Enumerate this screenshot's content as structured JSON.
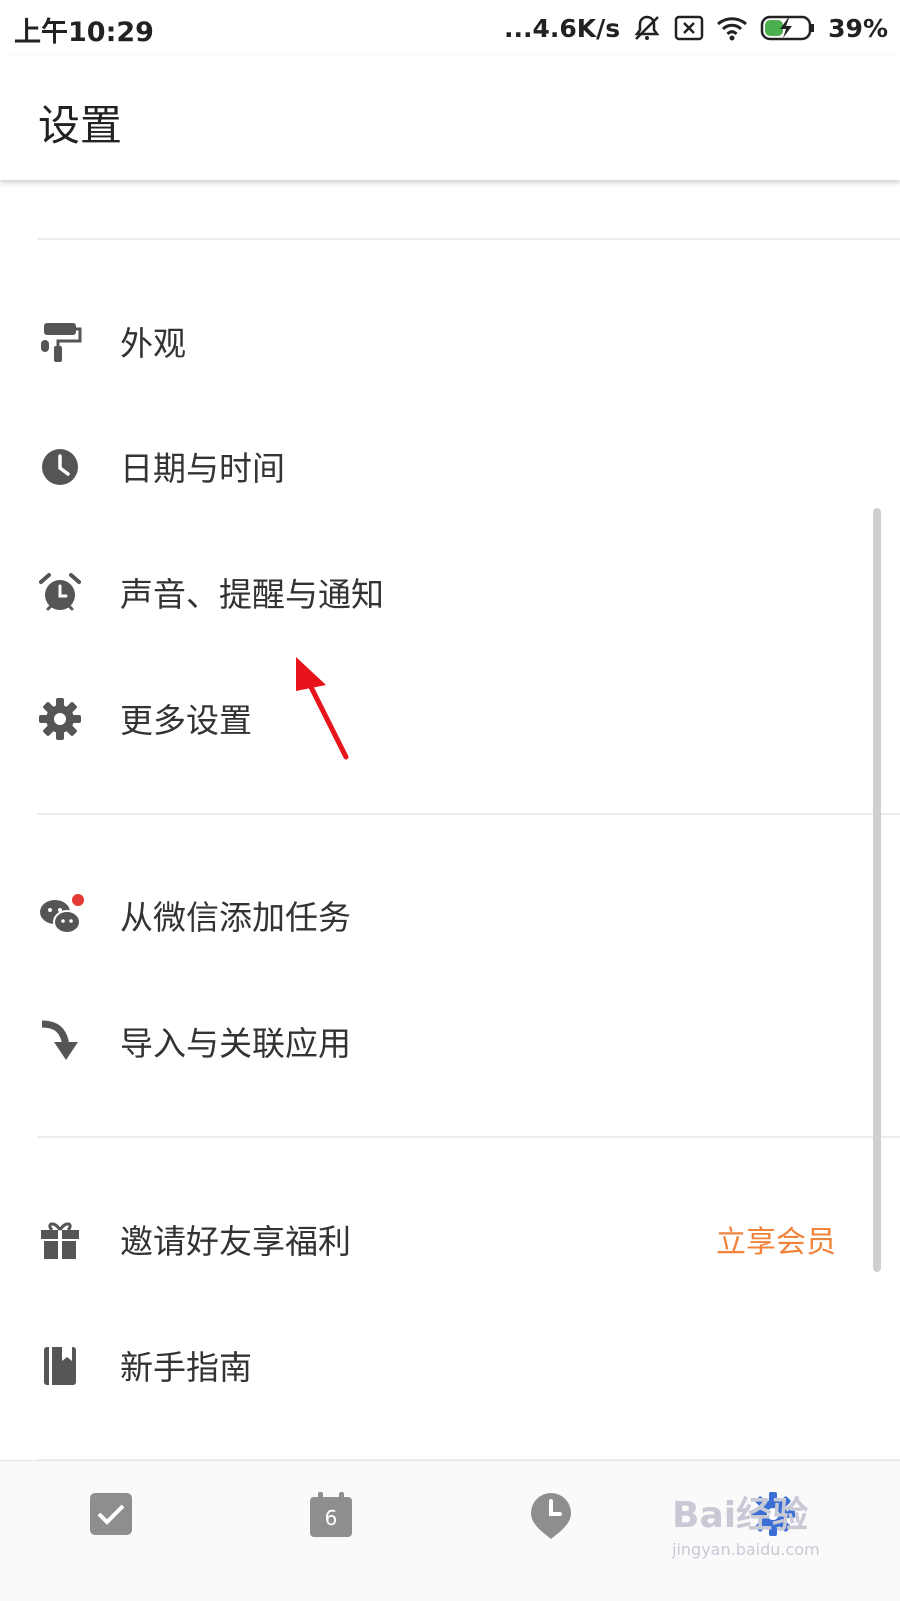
{
  "status_bar": {
    "time": "上午10:29",
    "network_speed": "...4.6K/s",
    "battery": "39%"
  },
  "header": {
    "title": "设置"
  },
  "groups": [
    {
      "items": [
        {
          "label": "外观",
          "icon": "paint-roller-icon"
        },
        {
          "label": "日期与时间",
          "icon": "clock-icon"
        },
        {
          "label": "声音、提醒与通知",
          "icon": "alarm-clock-icon"
        },
        {
          "label": "更多设置",
          "icon": "gear-icon"
        }
      ]
    },
    {
      "items": [
        {
          "label": "从微信添加任务",
          "icon": "wechat-icon",
          "has_red_dot": true
        },
        {
          "label": "导入与关联应用",
          "icon": "import-arrow-icon"
        }
      ]
    },
    {
      "items": [
        {
          "label": "邀请好友享福利",
          "icon": "gift-icon",
          "trailing": "立享会员"
        },
        {
          "label": "新手指南",
          "icon": "book-icon"
        }
      ]
    }
  ],
  "bottom_nav": {
    "items": [
      {
        "icon": "checkbox-icon"
      },
      {
        "icon": "calendar-icon",
        "day": "6"
      },
      {
        "icon": "clock-pin-icon"
      },
      {
        "icon": "settings-icon"
      }
    ]
  },
  "watermark": {
    "main": "Bai经验",
    "sub": "jingyan.baidu.com"
  },
  "colors": {
    "accent_orange": "#f0843c",
    "icon_gray": "#555555",
    "red_dot": "#e53935",
    "arrow_red": "#e8141b"
  }
}
